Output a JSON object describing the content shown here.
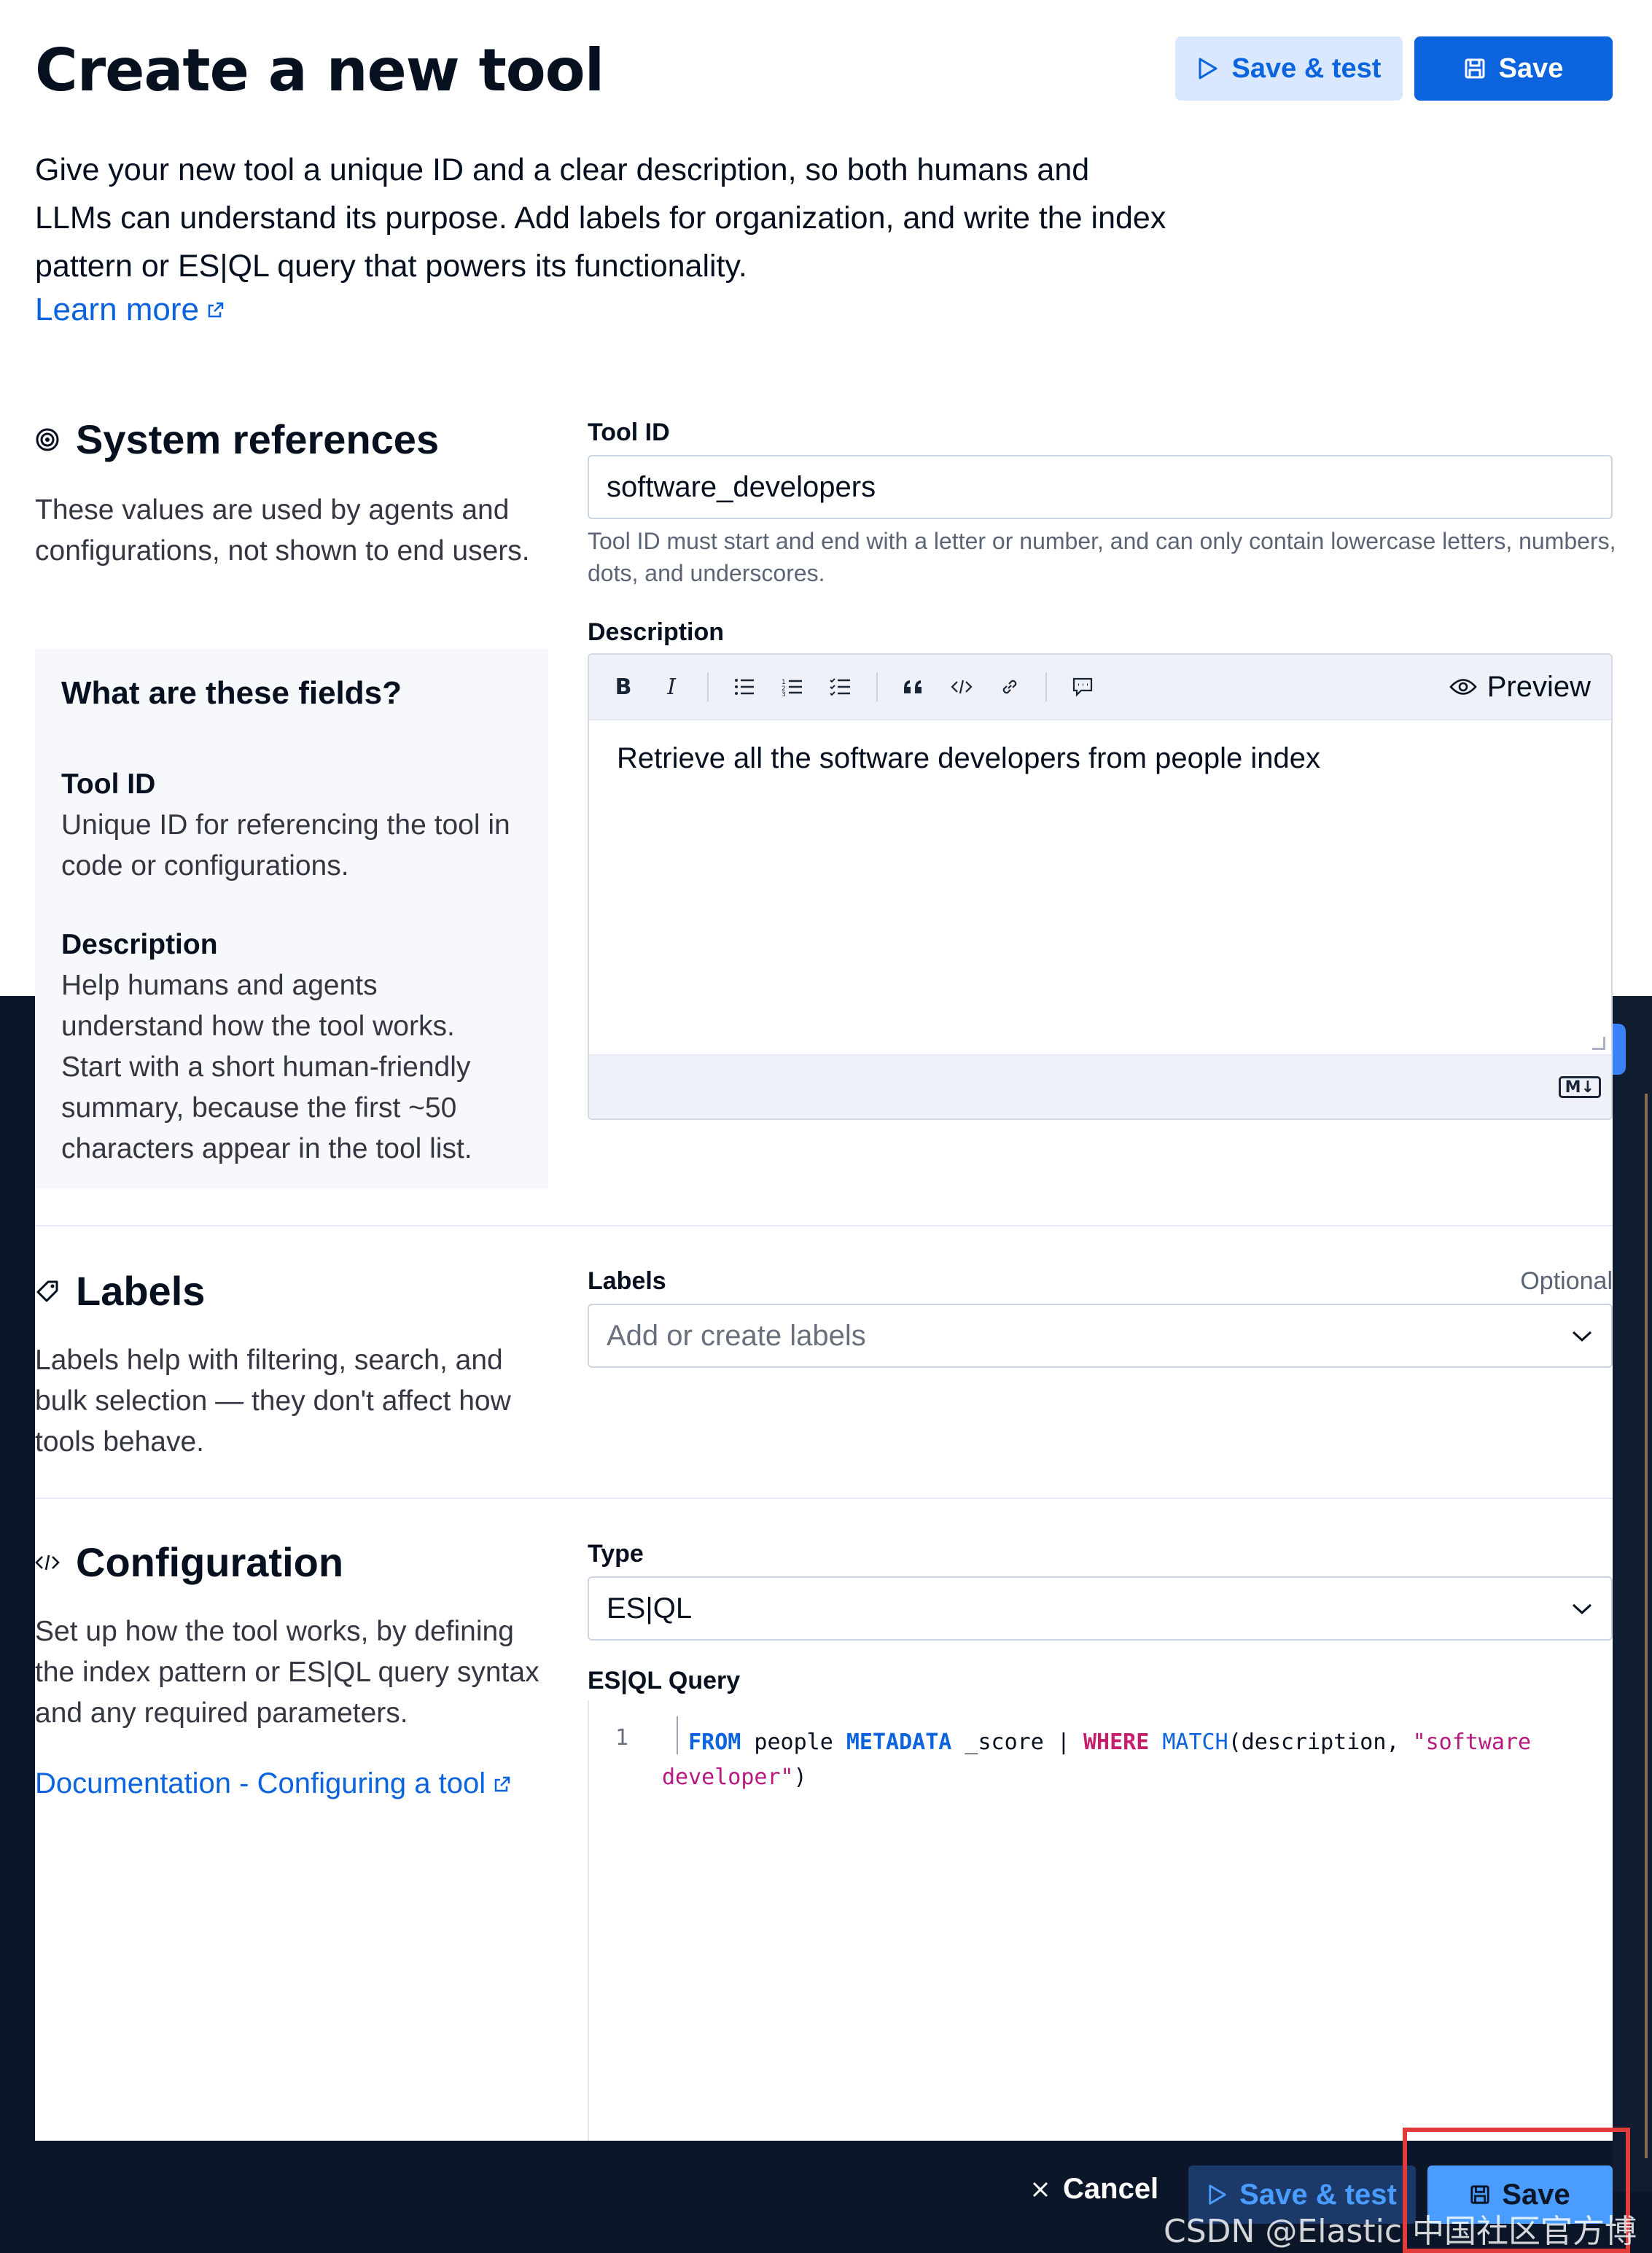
{
  "header": {
    "title": "Create a new tool",
    "save_test_label": "Save & test",
    "save_label": "Save",
    "intro": "Give your new tool a unique ID and a clear description, so both humans and LLMs can understand its purpose. Add labels for organization, and write the index pattern or ES|QL query that powers its functionality.",
    "learn_more": "Learn more"
  },
  "system_references": {
    "title": "System references",
    "description": "These values are used by agents and configurations, not shown to end users.",
    "help": {
      "title": "What are these fields?",
      "tool_id_term": "Tool ID",
      "tool_id_def": "Unique ID for referencing the tool in code or configurations.",
      "description_term": "Description",
      "description_def": "Help humans and agents understand how the tool works. Start with a short human-friendly summary, because the first ~50 characters appear in the tool list."
    }
  },
  "tool_id": {
    "label": "Tool ID",
    "value": "software_developers",
    "help": "Tool ID must start and end with a letter or number, and can only contain lowercase letters, numbers, dots, and underscores."
  },
  "description_field": {
    "label": "Description",
    "toolbar": {
      "bold": "B",
      "italic": "I",
      "preview": "Preview",
      "markdown_badge": "M↓"
    },
    "value": "Retrieve all the software developers from people index"
  },
  "labels_section": {
    "title": "Labels",
    "description": "Labels help with filtering, search, and bulk selection — they don't affect how tools behave.",
    "field_label": "Labels",
    "optional": "Optional",
    "placeholder": "Add or create labels"
  },
  "configuration": {
    "title": "Configuration",
    "description": "Set up how the tool works, by defining the index pattern or ES|QL query syntax and any required parameters.",
    "doc_link": "Documentation - Configuring a tool",
    "type_label": "Type",
    "type_value": "ES|QL",
    "query_label": "ES|QL Query",
    "line_number": "1",
    "query": {
      "from": "FROM",
      "index": " people ",
      "metadata": "METADATA",
      "score": " _score | ",
      "where": "WHERE",
      "match": " MATCH",
      "args": "(description, ",
      "string": "\"software developer\"",
      "close": ")"
    }
  },
  "bottom_bar": {
    "cancel": "Cancel",
    "save_test": "Save & test",
    "save": "Save"
  },
  "watermark": "CSDN @Elastic 中国社区官方博客",
  "colors": {
    "primary": "#0b64dd",
    "dark_bg": "#0b1628",
    "highlight": "#e23b3b"
  }
}
